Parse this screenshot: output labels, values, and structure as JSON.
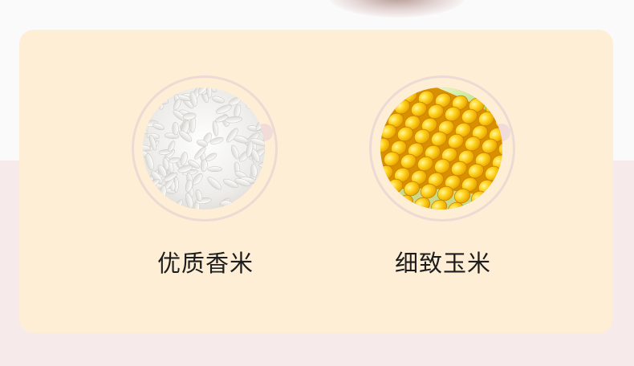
{
  "features": [
    {
      "id": "rice",
      "label": "优质香米",
      "image": "rice-grains-photo"
    },
    {
      "id": "corn",
      "label": "细致玉米",
      "image": "corn-cob-photo"
    }
  ],
  "colors": {
    "card_bg": "#feeed5",
    "ring": "#ecdad4",
    "ring_dot": "#f1dcd9",
    "label_text": "#1d1d1d"
  }
}
